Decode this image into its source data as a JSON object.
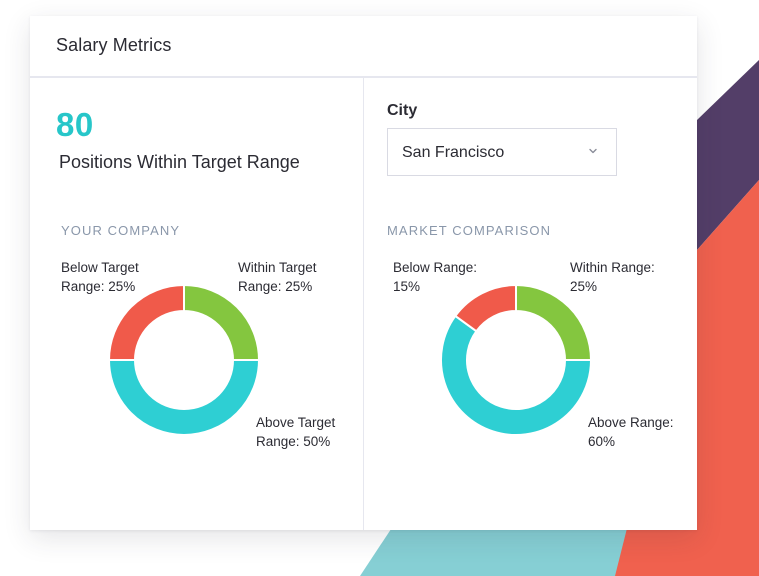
{
  "window": {
    "title": "Salary Metrics"
  },
  "summary": {
    "value": "80",
    "label": "Positions Within Target Range"
  },
  "filters": {
    "city_label": "City",
    "city_selected": "San Francisco",
    "chevron_icon": "chevron-down-icon"
  },
  "your_company": {
    "heading": "YOUR COMPANY",
    "segments": [
      {
        "line1": "Below Target",
        "line2": "Range: 25%",
        "value": 25,
        "color": "#f05a4a"
      },
      {
        "line1": "Within Target",
        "line2": "Range: 25%",
        "value": 25,
        "color": "#84c63f"
      },
      {
        "line1": "Above Target",
        "line2": "Range: 50%",
        "value": 50,
        "color": "#2ecfd3"
      }
    ]
  },
  "market": {
    "heading": "MARKET COMPARISON",
    "segments": [
      {
        "line1": "Below Range:",
        "line2": "15%",
        "value": 15,
        "color": "#f05a4a"
      },
      {
        "line1": "Within Range:",
        "line2": "25%",
        "value": 25,
        "color": "#84c63f"
      },
      {
        "line1": "Above Range:",
        "line2": "60%",
        "value": 60,
        "color": "#2ecfd3"
      }
    ]
  },
  "chart_data": [
    {
      "type": "pie",
      "title": "YOUR COMPANY",
      "categories": [
        "Below Target Range",
        "Within Target Range",
        "Above Target Range"
      ],
      "values": [
        25,
        25,
        50
      ]
    },
    {
      "type": "pie",
      "title": "MARKET COMPARISON",
      "categories": [
        "Below Range",
        "Within Range",
        "Above Range"
      ],
      "values": [
        15,
        25,
        60
      ]
    }
  ],
  "theme": {
    "accent": "#27c6c9",
    "background_shapes": [
      "#533e68",
      "#f0614e",
      "#86cfd4"
    ]
  }
}
